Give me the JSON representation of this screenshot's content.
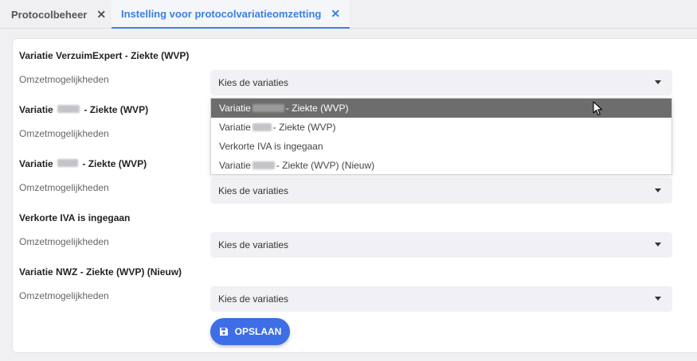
{
  "tabs": [
    {
      "label": "Protocolbeheer",
      "close": "✕"
    },
    {
      "label": "Instelling voor protocolvariatieomzetting",
      "close": "✕"
    }
  ],
  "sections": [
    {
      "title": "Variatie VerzuimExpert - Ziekte (WVP)",
      "label": "Omzetmogelijkheden",
      "select": "Kies de variaties"
    },
    {
      "title_prefix": "Variatie",
      "title_suffix": "- Ziekte (WVP)",
      "label": "Omzetmogelijkheden"
    },
    {
      "title_prefix": "Variatie",
      "title_suffix": "- Ziekte (WVP)",
      "label": "Omzetmogelijkheden",
      "select": "Kies de variaties"
    },
    {
      "title": "Verkorte IVA is ingegaan",
      "label": "Omzetmogelijkheden",
      "select": "Kies de variaties"
    },
    {
      "title": "Variatie NWZ - Ziekte (WVP) (Nieuw)",
      "label": "Omzetmogelijkheden",
      "select": "Kies de variaties"
    }
  ],
  "dropdown": {
    "options": [
      {
        "prefix": "Variatie",
        "suffix": "- Ziekte (WVP)"
      },
      {
        "prefix": "Variatie",
        "suffix": "- Ziekte (WVP)"
      },
      {
        "text": "Verkorte IVA is ingegaan"
      },
      {
        "prefix": "Variatie",
        "suffix": "- Ziekte (WVP) (Nieuw)"
      }
    ]
  },
  "save_button": {
    "label": "OPSLAAN",
    "icon": "save-icon"
  },
  "colors": {
    "accent": "#3d7fe0",
    "button": "#3d6ee6",
    "highlight": "#6d6d6d"
  }
}
